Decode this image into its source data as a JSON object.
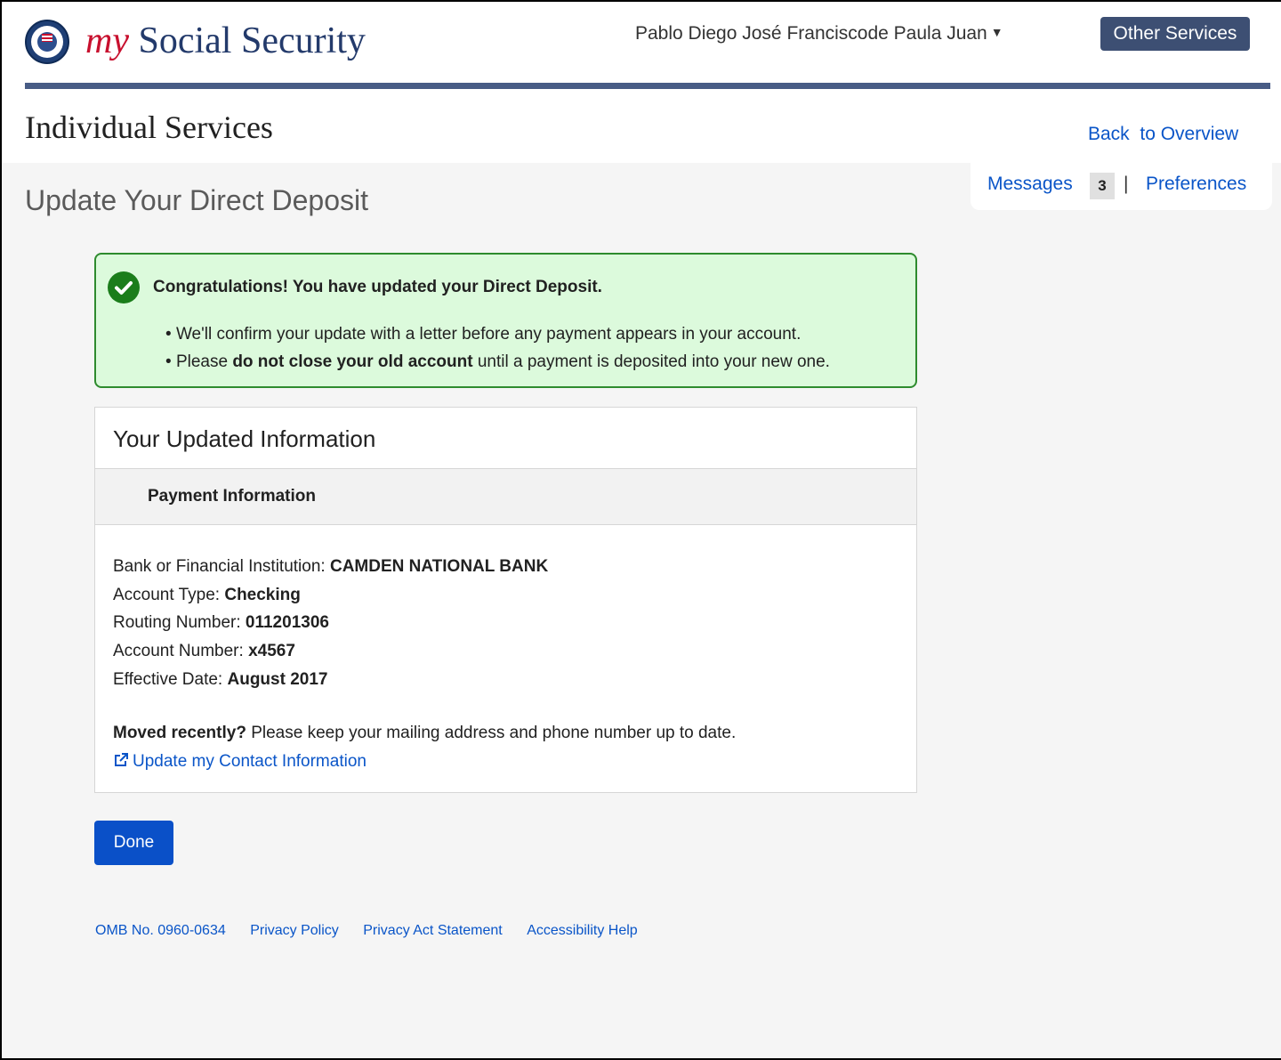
{
  "header": {
    "brand_my": "my",
    "brand_name": " Social Security",
    "user_name": "Pablo Diego José Franciscode Paula Juan",
    "other_services": "Other Services"
  },
  "section": {
    "title": "Individual Services",
    "back_link": "Back  to Overview"
  },
  "utility": {
    "messages_label": "Messages",
    "messages_count": "3",
    "separator": "|",
    "preferences_label": "Preferences"
  },
  "page": {
    "title": "Update Your Direct Deposit"
  },
  "alert": {
    "heading": "Congratulations! You have updated your Direct Deposit.",
    "item1": "We'll confirm your update with a letter before any payment appears in your account.",
    "item2_prefix": "Please ",
    "item2_bold": "do not close your old account",
    "item2_suffix": " until a payment is deposited into your new one."
  },
  "card": {
    "title": "Your Updated Information",
    "subheader": "Payment Information",
    "fields": [
      {
        "label": "Bank or Financial Institution: ",
        "value": "CAMDEN NATIONAL BANK"
      },
      {
        "label": "Account Type: ",
        "value": "Checking"
      },
      {
        "label": "Routing Number: ",
        "value": "011201306"
      },
      {
        "label": "Account Number: ",
        "value": "x4567"
      },
      {
        "label": "Effective Date: ",
        "value": "August 2017"
      }
    ],
    "moved_bold": "Moved recently?",
    "moved_text": " Please keep your mailing address and phone number up to date.",
    "contact_link": "Update my Contact Information"
  },
  "actions": {
    "done": "Done"
  },
  "footer": {
    "links": [
      "OMB No. 0960-0634",
      "Privacy Policy",
      "Privacy Act Statement",
      "Accessibility Help"
    ]
  },
  "colors": {
    "brand_navy": "#233a6b",
    "brand_red": "#c8102e",
    "link_blue": "#0a55c8",
    "success_bg": "#dcfadc",
    "success_border": "#2e8b2e",
    "primary_button": "#0a50c8"
  }
}
